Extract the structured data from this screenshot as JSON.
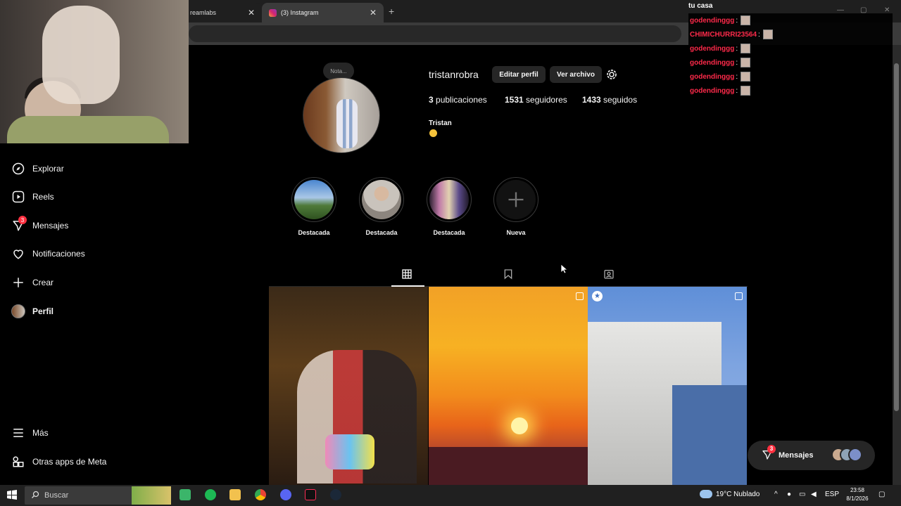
{
  "browser": {
    "tabs": [
      {
        "label": "reamlabs"
      },
      {
        "label": "(3) Instagram"
      }
    ],
    "new_tab": "+"
  },
  "sidebar": {
    "items": [
      {
        "label": "Explorar",
        "icon": "compass-icon"
      },
      {
        "label": "Reels",
        "icon": "reels-icon"
      },
      {
        "label": "Mensajes",
        "icon": "messenger-icon",
        "badge": "3"
      },
      {
        "label": "Notificaciones",
        "icon": "heart-icon"
      },
      {
        "label": "Crear",
        "icon": "plus-icon"
      },
      {
        "label": "Perfil",
        "icon": "avatar"
      }
    ],
    "bottom": [
      {
        "label": "Más",
        "icon": "menu-icon"
      },
      {
        "label": "Otras apps de Meta",
        "icon": "apps-icon"
      }
    ]
  },
  "profile": {
    "nota": "Nota...",
    "username": "tristanrobra",
    "edit_label": "Editar perfil",
    "archive_label": "Ver archivo",
    "stats": {
      "posts_n": "3",
      "posts_label": "publicaciones",
      "followers_n": "1531",
      "followers_label": "seguidores",
      "following_n": "1433",
      "following_label": "seguidos"
    },
    "full_name": "Tristan"
  },
  "highlights": [
    {
      "label": "Destacada"
    },
    {
      "label": "Destacada"
    },
    {
      "label": "Destacada"
    },
    {
      "label": "Nueva"
    }
  ],
  "chat": {
    "title": "tu casa",
    "messages": [
      {
        "user": "godendinggg",
        "sep": ":"
      },
      {
        "user": "CHIMICHURRI23564",
        "sep": ":"
      },
      {
        "user": "godendinggg",
        "sep": ":"
      },
      {
        "user": "godendinggg",
        "sep": ":"
      },
      {
        "user": "godendinggg",
        "sep": ":"
      },
      {
        "user": "godendinggg",
        "sep": ":"
      }
    ]
  },
  "messages_float": {
    "label": "Mensajes",
    "badge": "3"
  },
  "taskbar": {
    "search_placeholder": "Buscar",
    "weather": "19°C  Nublado",
    "lang": "ESP",
    "time": "23:58",
    "date": "8/1/2026"
  },
  "colors": {
    "badge": "#ff3040",
    "chat_user": "#ff2a4a",
    "bg": "#000000",
    "button_bg": "#262626"
  }
}
